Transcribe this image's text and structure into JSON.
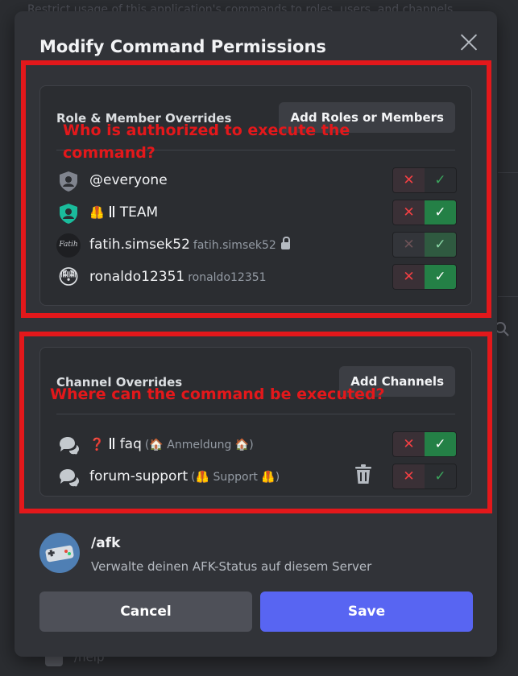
{
  "background": {
    "top_text": "Restrict usage of this application's commands to roles, users, and channels.",
    "bottom_item": "/help"
  },
  "modal": {
    "title": "Modify Command Permissions",
    "roles_section": {
      "header": "Role & Member Overrides",
      "add_button": "Add Roles or Members",
      "rows": [
        {
          "name": "@everyone",
          "avatar_icon": "everyone-role-icon",
          "allowed": true,
          "allow_active": false
        },
        {
          "name": "TEAM",
          "emoji": "🦺",
          "avatar_icon": "team-role-icon",
          "allowed": true,
          "allow_active": true
        },
        {
          "name": "fatih.simsek52",
          "username": "fatih.simsek52",
          "locked": true,
          "avatar_icon": "fatih-avatar",
          "avatar_text": "Fatih",
          "allowed": true,
          "allow_active": false
        },
        {
          "name": "ronaldo12351",
          "username": "ronaldo12351",
          "avatar_icon": "flushed-face-avatar",
          "avatar_emoji": "😳",
          "allowed": true,
          "allow_active": true
        }
      ]
    },
    "channels_section": {
      "header": "Channel Overrides",
      "add_button": "Add Channels",
      "rows": [
        {
          "emoji": "❓",
          "name": "faq",
          "category_emoji": "🏠",
          "category": "Anmeldung",
          "channel_icon": "forum-channel-icon",
          "allow_active": true
        },
        {
          "name": "forum-support",
          "category_emoji": "🦺",
          "category": "Support",
          "channel_icon": "forum-channel-icon",
          "allow_active": false
        }
      ]
    },
    "command": {
      "name": "/afk",
      "description": "Verwalte deinen AFK-Status auf diesem Server",
      "icon": "gamepad-app-icon"
    },
    "cancel_label": "Cancel",
    "save_label": "Save"
  },
  "annotations": {
    "roles_note": "Who is authorized to execute the command?",
    "channels_note": "Where can the command be executed?",
    "color": "#e3181b"
  },
  "colors": {
    "accent": "#5865f2",
    "allow_green": "#248046",
    "deny_red": "#f23f43",
    "modal_bg": "#313338"
  }
}
